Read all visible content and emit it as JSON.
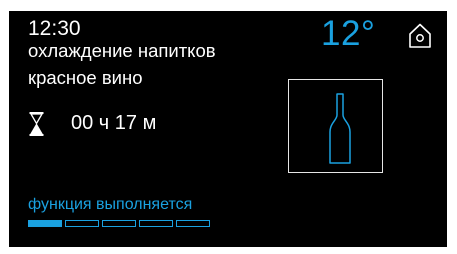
{
  "clock": {
    "time": "12:30"
  },
  "mode": {
    "label": "охлаждение напитков"
  },
  "program": {
    "label": "красное вино"
  },
  "timer": {
    "value": "00 ч 17 м"
  },
  "temperature": {
    "value": "12°"
  },
  "status": {
    "text": "функция выполняется"
  },
  "progress": {
    "filled_segments": 1,
    "total_segments": 5
  },
  "icons": {
    "home": "home-icon",
    "hourglass": "hourglass-icon",
    "bottle": "wine-bottle-icon"
  },
  "colors": {
    "accent": "#1aa1e0",
    "background": "#000000",
    "text": "#ffffff"
  }
}
